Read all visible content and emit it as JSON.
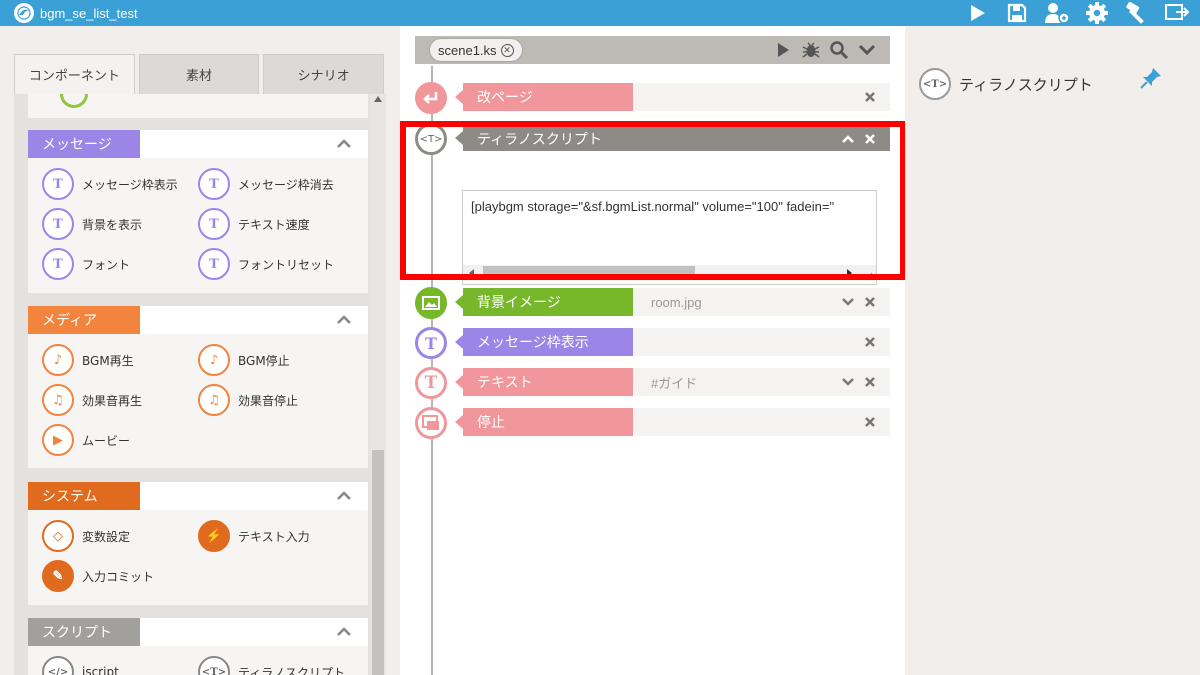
{
  "app": {
    "title": "bgm_se_list_test"
  },
  "toolbar": {
    "icons": [
      "play-icon",
      "save-icon",
      "user-settings-icon",
      "gear-icon",
      "hammer-icon",
      "export-icon"
    ]
  },
  "left_tabs": [
    "コンポーネント",
    "素材",
    "シナリオ"
  ],
  "categories": {
    "message": {
      "title": "メッセージ",
      "color": "#9b86e8",
      "items": [
        "メッセージ枠表示",
        "メッセージ枠消去",
        "背景を表示",
        "テキスト速度",
        "フォント",
        "フォントリセット"
      ]
    },
    "media": {
      "title": "メディア",
      "color": "#f2843e",
      "items": [
        "BGM再生",
        "BGM停止",
        "効果音再生",
        "効果音停止",
        "ムービー"
      ]
    },
    "system": {
      "title": "システム",
      "color": "#e06a1e",
      "items": [
        "変数設定",
        "テキスト入力",
        "入力コミット"
      ]
    },
    "script": {
      "title": "スクリプト",
      "color": "#a2a09d",
      "items": [
        "iscript",
        "ティラノスクリプト"
      ]
    }
  },
  "editor": {
    "file_tab": "scene1.ks",
    "blocks": [
      {
        "label": "改ページ",
        "param": "",
        "color": "#f1969a"
      },
      {
        "label": "ティラノスクリプト",
        "param": "",
        "color": "#8e8b87",
        "script": "[playbgm storage=\"&sf.bgmList.normal\" volume=\"100\" fadein=\""
      },
      {
        "label": "背景イメージ",
        "param": "room.jpg",
        "color": "#76b82a"
      },
      {
        "label": "メッセージ枠表示",
        "param": "",
        "color": "#9b86e8"
      },
      {
        "label": "テキスト",
        "param": "#ガイド",
        "color": "#f1969a"
      },
      {
        "label": "停止",
        "param": "",
        "color": "#f1969a"
      }
    ]
  },
  "right_panel": {
    "item_label": "ティラノスクリプト",
    "icon_text": "<T>"
  }
}
